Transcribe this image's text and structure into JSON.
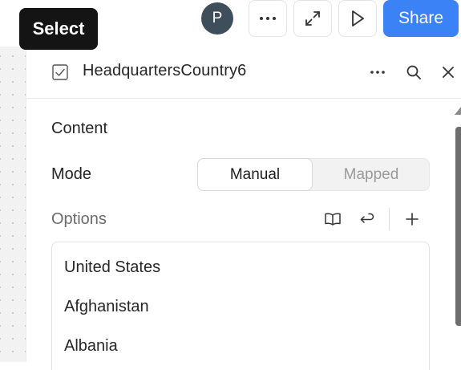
{
  "tooltip": {
    "text": "Select"
  },
  "toolbar": {
    "avatar_initial": "P",
    "more_icon": "more-horizontal-icon",
    "expand_icon": "expand-icon",
    "play_icon": "play-icon",
    "share_label": "Share",
    "share_color": "#3b82f6"
  },
  "panel": {
    "title": "HeadquartersCountry6",
    "title_icon": "checkbox-icon",
    "section_title": "Content",
    "mode_label": "Mode",
    "mode_options": [
      "Manual",
      "Mapped"
    ],
    "mode_selected": "Manual",
    "options_label": "Options",
    "options_icons": [
      "book-icon",
      "return-icon",
      "plus-icon"
    ],
    "options": [
      "United States",
      "Afghanistan",
      "Albania"
    ]
  }
}
